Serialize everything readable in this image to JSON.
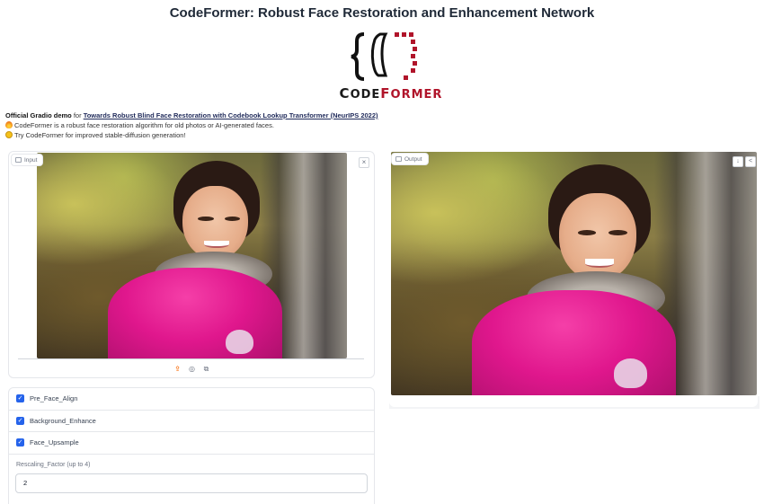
{
  "header": {
    "title": "CodeFormer: Robust Face Restoration and Enhancement Network"
  },
  "logo": {
    "word_part1_initial": "C",
    "word_part1": "ODE",
    "word_part2_initial": "F",
    "word_part2": "ORMER"
  },
  "description": {
    "line1_bold": "Official Gradio demo",
    "line1_text": " for ",
    "line1_link": "Towards Robust Blind Face Restoration with Codebook Lookup Transformer (NeurIPS 2022)",
    "line2": "CodeFormer is a robust face restoration algorithm for old photos or AI-generated faces.",
    "line3": "Try CodeFormer for improved stable-diffusion generation!"
  },
  "input_panel": {
    "label": "Input",
    "close_symbol": "×",
    "tools": [
      "upload-icon",
      "webcam-icon",
      "clipboard-icon"
    ]
  },
  "output_panel": {
    "label": "Output",
    "buttons": [
      "download-icon",
      "share-icon"
    ]
  },
  "options": {
    "pre_face_align": {
      "label": "Pre_Face_Align",
      "checked": true
    },
    "background_enhance": {
      "label": "Background_Enhance",
      "checked": true
    },
    "face_upsample": {
      "label": "Face_Upsample",
      "checked": true
    },
    "rescaling_factor": {
      "label": "Rescaling_Factor (up to 4)",
      "value": "2"
    }
  },
  "colors": {
    "accent": "#2563eb",
    "logo_red": "#b0142a",
    "upload_orange": "#f97316"
  }
}
